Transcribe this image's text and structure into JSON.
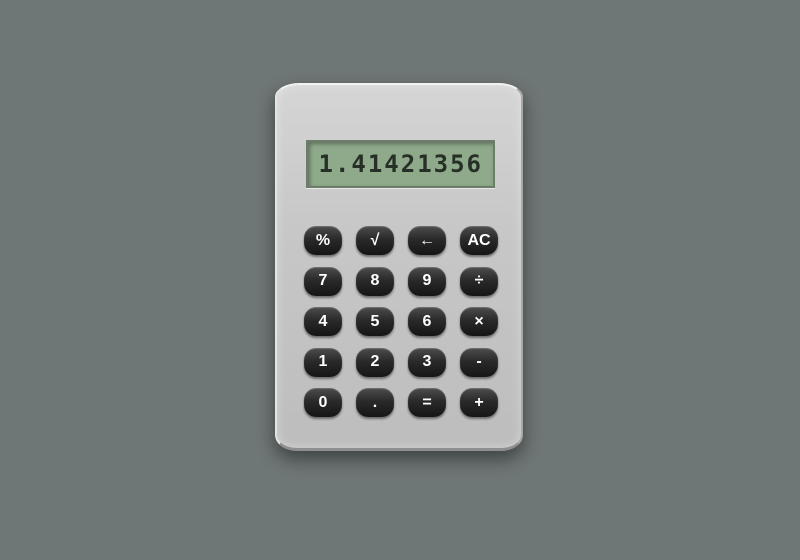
{
  "display": {
    "value": "1.41421356"
  },
  "keys": [
    {
      "name": "percent-button",
      "label": "%"
    },
    {
      "name": "sqrt-button",
      "label": "√"
    },
    {
      "name": "backspace-button",
      "label": "←"
    },
    {
      "name": "all-clear-button",
      "label": "AC"
    },
    {
      "name": "digit-7-button",
      "label": "7"
    },
    {
      "name": "digit-8-button",
      "label": "8"
    },
    {
      "name": "digit-9-button",
      "label": "9"
    },
    {
      "name": "divide-button",
      "label": "÷"
    },
    {
      "name": "digit-4-button",
      "label": "4"
    },
    {
      "name": "digit-5-button",
      "label": "5"
    },
    {
      "name": "digit-6-button",
      "label": "6"
    },
    {
      "name": "multiply-button",
      "label": "×"
    },
    {
      "name": "digit-1-button",
      "label": "1"
    },
    {
      "name": "digit-2-button",
      "label": "2"
    },
    {
      "name": "digit-3-button",
      "label": "3"
    },
    {
      "name": "subtract-button",
      "label": "-"
    },
    {
      "name": "digit-0-button",
      "label": "0"
    },
    {
      "name": "decimal-point-button",
      "label": "."
    },
    {
      "name": "equals-button",
      "label": "="
    },
    {
      "name": "add-button",
      "label": "+"
    }
  ],
  "colors": {
    "background": "#6f7676",
    "body": "#c7c7c7",
    "lcd": "#8faa8b",
    "lcd_text": "#273026",
    "key": "#2a2a2a",
    "key_text": "#ffffff"
  }
}
